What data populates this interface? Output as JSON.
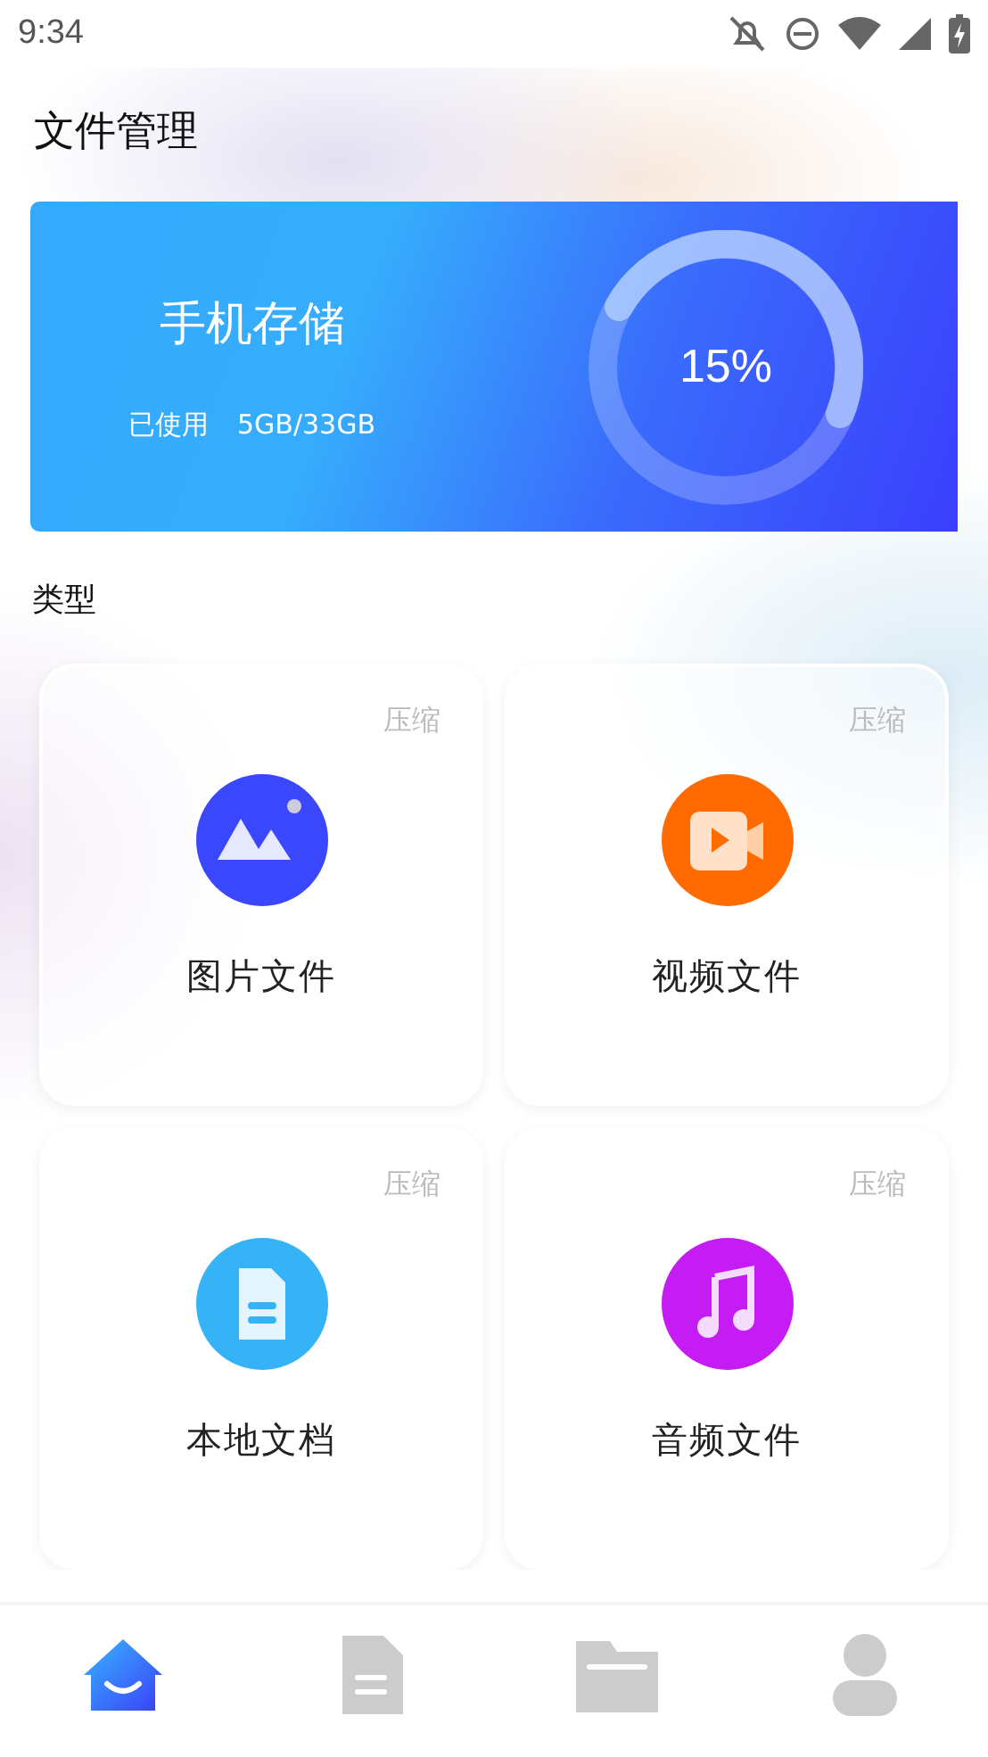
{
  "status_bar": {
    "time": "9:34"
  },
  "page_title": "文件管理",
  "storage": {
    "title": "手机存储",
    "used_label": "已使用",
    "used_value": "5GB/33GB",
    "percent": "15%"
  },
  "section_title": "类型",
  "categories": [
    {
      "kind": "image",
      "label": "图片文件",
      "action": "压缩"
    },
    {
      "kind": "video",
      "label": "视频文件",
      "action": "压缩"
    },
    {
      "kind": "document",
      "label": "本地文档",
      "action": "压缩"
    },
    {
      "kind": "music",
      "label": "音频文件",
      "action": "压缩"
    }
  ],
  "nav": [
    {
      "kind": "home",
      "selected": true
    },
    {
      "kind": "document",
      "selected": false
    },
    {
      "kind": "folder",
      "selected": false
    },
    {
      "kind": "person",
      "selected": false
    }
  ]
}
